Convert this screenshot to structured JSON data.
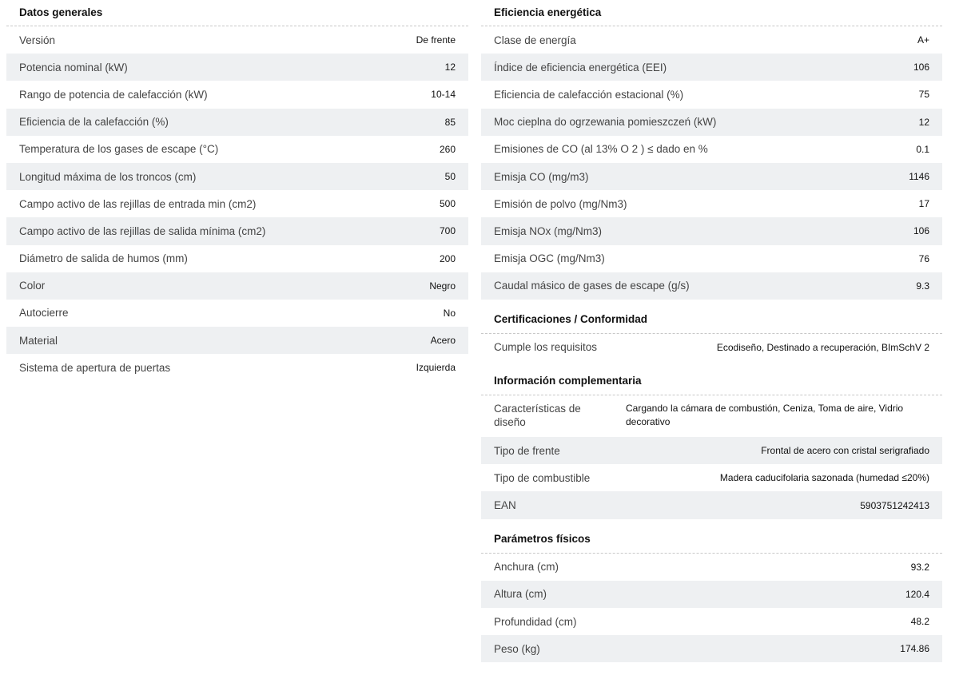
{
  "general": {
    "title": "Datos generales",
    "rows": [
      {
        "label": "Versión",
        "value": "De frente"
      },
      {
        "label": "Potencia nominal (kW)",
        "value": "12"
      },
      {
        "label": "Rango de potencia de calefacción (kW)",
        "value": "10-14"
      },
      {
        "label": "Eficiencia de la calefacción (%)",
        "value": "85"
      },
      {
        "label": "Temperatura de los gases de escape (°C)",
        "value": "260"
      },
      {
        "label": "Longitud máxima de los troncos (cm)",
        "value": "50"
      },
      {
        "label": "Campo activo de las rejillas de entrada min (cm2)",
        "value": "500"
      },
      {
        "label": "Campo activo de las rejillas de salida mínima (cm2)",
        "value": "700"
      },
      {
        "label": "Diámetro de salida de humos (mm)",
        "value": "200"
      },
      {
        "label": "Color",
        "value": "Negro"
      },
      {
        "label": "Autocierre",
        "value": "No"
      },
      {
        "label": "Material",
        "value": "Acero"
      },
      {
        "label": "Sistema de apertura de puertas",
        "value": "Izquierda"
      }
    ]
  },
  "energy": {
    "title": "Eficiencia energética",
    "rows": [
      {
        "label": "Clase de energía",
        "value": "A+"
      },
      {
        "label": "Índice de eficiencia energética (EEI)",
        "value": "106"
      },
      {
        "label": "Eficiencia de calefacción estacional (%)",
        "value": "75"
      },
      {
        "label": "Moc cieplna do ogrzewania pomieszczeń (kW)",
        "value": "12"
      },
      {
        "label": "Emisiones de CO (al 13% O 2 ) ≤ dado en %",
        "value": "0.1"
      },
      {
        "label": "Emisja CO (mg/m3)",
        "value": "1146"
      },
      {
        "label": "Emisión de polvo (mg/Nm3)",
        "value": "17"
      },
      {
        "label": "Emisja NOx (mg/Nm3)",
        "value": "106"
      },
      {
        "label": "Emisja OGC (mg/Nm3)",
        "value": "76"
      },
      {
        "label": "Caudal másico de gases de escape (g/s)",
        "value": "9.3"
      }
    ]
  },
  "certifications": {
    "title": "Certificaciones / Conformidad",
    "rows": [
      {
        "label": "Cumple los requisitos",
        "value": "Ecodiseño, Destinado a recuperación, BImSchV 2"
      }
    ]
  },
  "additional": {
    "title": "Información complementaria",
    "rows": [
      {
        "label": "Características de diseño",
        "value": "Cargando la cámara de combustión, Ceniza, Toma de aire, Vidrio decorativo"
      },
      {
        "label": "Tipo de frente",
        "value": "Frontal de acero con cristal serigrafiado"
      },
      {
        "label": "Tipo de combustible",
        "value": "Madera caducifolaria sazonada (humedad ≤20%)"
      },
      {
        "label": "EAN",
        "value": "5903751242413"
      }
    ]
  },
  "physical": {
    "title": "Parámetros físicos",
    "rows": [
      {
        "label": "Anchura (cm)",
        "value": "93.2"
      },
      {
        "label": "Altura (cm)",
        "value": "120.4"
      },
      {
        "label": "Profundidad (cm)",
        "value": "48.2"
      },
      {
        "label": "Peso (kg)",
        "value": "174.86"
      }
    ]
  }
}
